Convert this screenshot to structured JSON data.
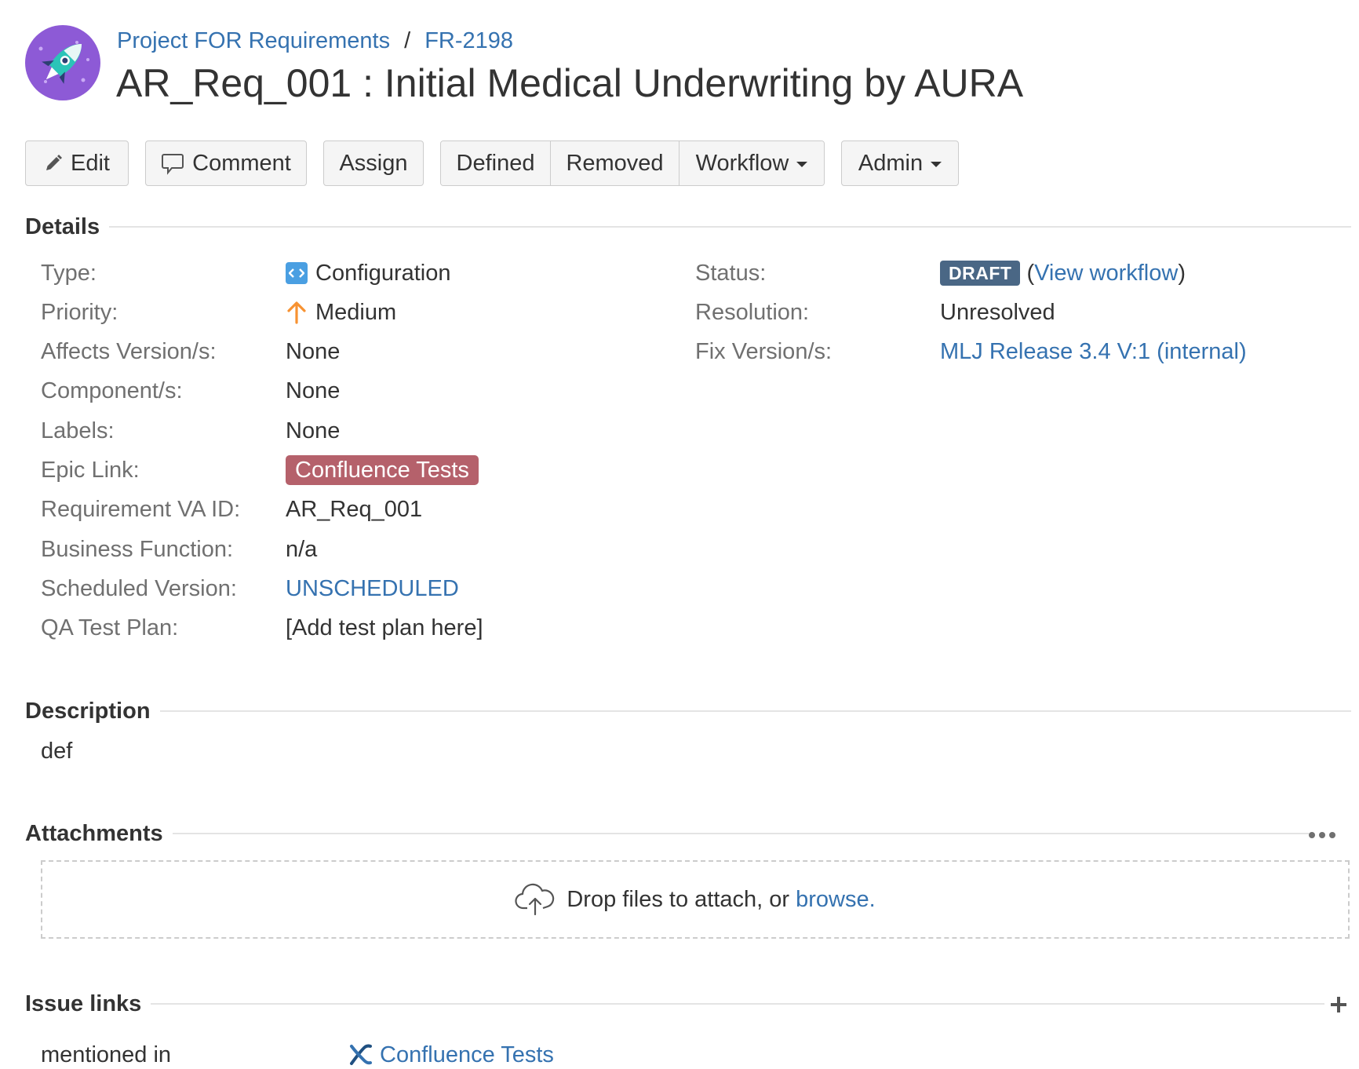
{
  "header": {
    "project_link": "Project FOR Requirements",
    "separator": "/",
    "issue_key": "FR-2198",
    "title": "AR_Req_001 : Initial Medical Underwriting by AURA"
  },
  "toolbar": {
    "edit": "Edit",
    "comment": "Comment",
    "assign": "Assign",
    "defined": "Defined",
    "removed": "Removed",
    "workflow": "Workflow",
    "admin": "Admin"
  },
  "details": {
    "heading": "Details",
    "left": [
      {
        "label": "Type:",
        "value": "Configuration"
      },
      {
        "label": "Priority:",
        "value": "Medium"
      },
      {
        "label": "Affects Version/s:",
        "value": "None"
      },
      {
        "label": "Component/s:",
        "value": "None"
      },
      {
        "label": "Labels:",
        "value": "None"
      },
      {
        "label": "Epic Link:",
        "value": "Confluence Tests"
      },
      {
        "label": "Requirement VA ID:",
        "value": "AR_Req_001"
      },
      {
        "label": "Business Function:",
        "value": "n/a"
      },
      {
        "label": "Scheduled Version:",
        "value": "UNSCHEDULED"
      },
      {
        "label": "QA Test Plan:",
        "value": "[Add test plan here]"
      }
    ],
    "right": [
      {
        "label": "Status:",
        "value": "DRAFT",
        "extra_open": "(",
        "extra_link": "View workflow",
        "extra_close": ")"
      },
      {
        "label": "Resolution:",
        "value": "Unresolved"
      },
      {
        "label": "Fix Version/s:",
        "value": "MLJ Release 3.4 V:1 (internal)"
      }
    ]
  },
  "description": {
    "heading": "Description",
    "text": "def"
  },
  "attachments": {
    "heading": "Attachments",
    "drop_text": "Drop files to attach, or",
    "browse_link": "browse."
  },
  "issue_links": {
    "heading": "Issue links",
    "relation": "mentioned in",
    "link_text": "Confluence Tests"
  },
  "colors": {
    "link": "#3572b0",
    "draft_lozenge": "#4a6785",
    "epic_lozenge": "#b5616b",
    "priority_medium": "#f79232",
    "type_icon": "#4a9fe2",
    "avatar": "#8d5ad6"
  },
  "icons": {
    "avatar": "rocket-avatar-icon",
    "edit": "pencil-icon",
    "comment": "speech-bubble-icon",
    "type": "code-brackets-icon",
    "priority": "arrow-up-icon",
    "attachments_menu": "more-dots-icon",
    "upload": "cloud-upload-icon",
    "add_link": "plus-icon",
    "confluence": "confluence-x-icon"
  }
}
